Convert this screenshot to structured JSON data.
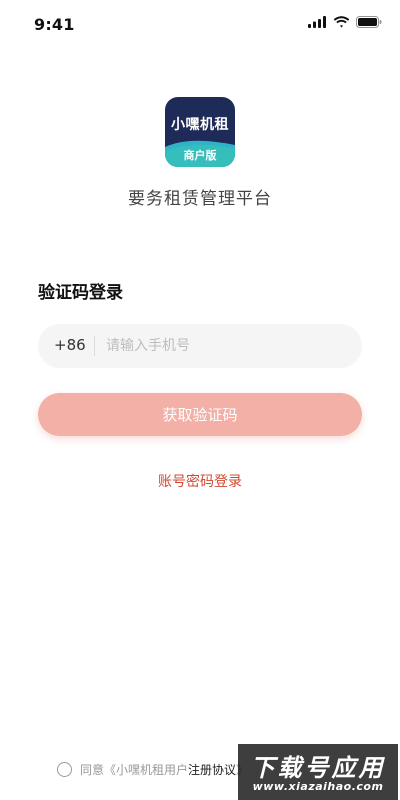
{
  "status_bar": {
    "time": "9:41",
    "icons": [
      "signal-icon",
      "wifi-icon",
      "battery-icon"
    ]
  },
  "app": {
    "logo_title": "小嘿机租",
    "logo_badge": "商户版",
    "platform_name": "要务租赁管理平台"
  },
  "login": {
    "heading": "验证码登录",
    "country_code": "+86",
    "phone_placeholder": "请输入手机号",
    "phone_value": "",
    "get_code_label": "获取验证码",
    "password_login_label": "账号密码登录"
  },
  "agreement": {
    "prefix": "同意《小嘿机租用户",
    "link_label": "注册协议",
    "suffix": "》"
  },
  "watermark": {
    "main": "下载号应用",
    "sub": "www.xiazaihao.com"
  },
  "colors": {
    "primary_button": "#f2b0a6",
    "link": "#d4482f",
    "logo_bg": "#1e2a57",
    "logo_wave": "#2fb3c9"
  }
}
